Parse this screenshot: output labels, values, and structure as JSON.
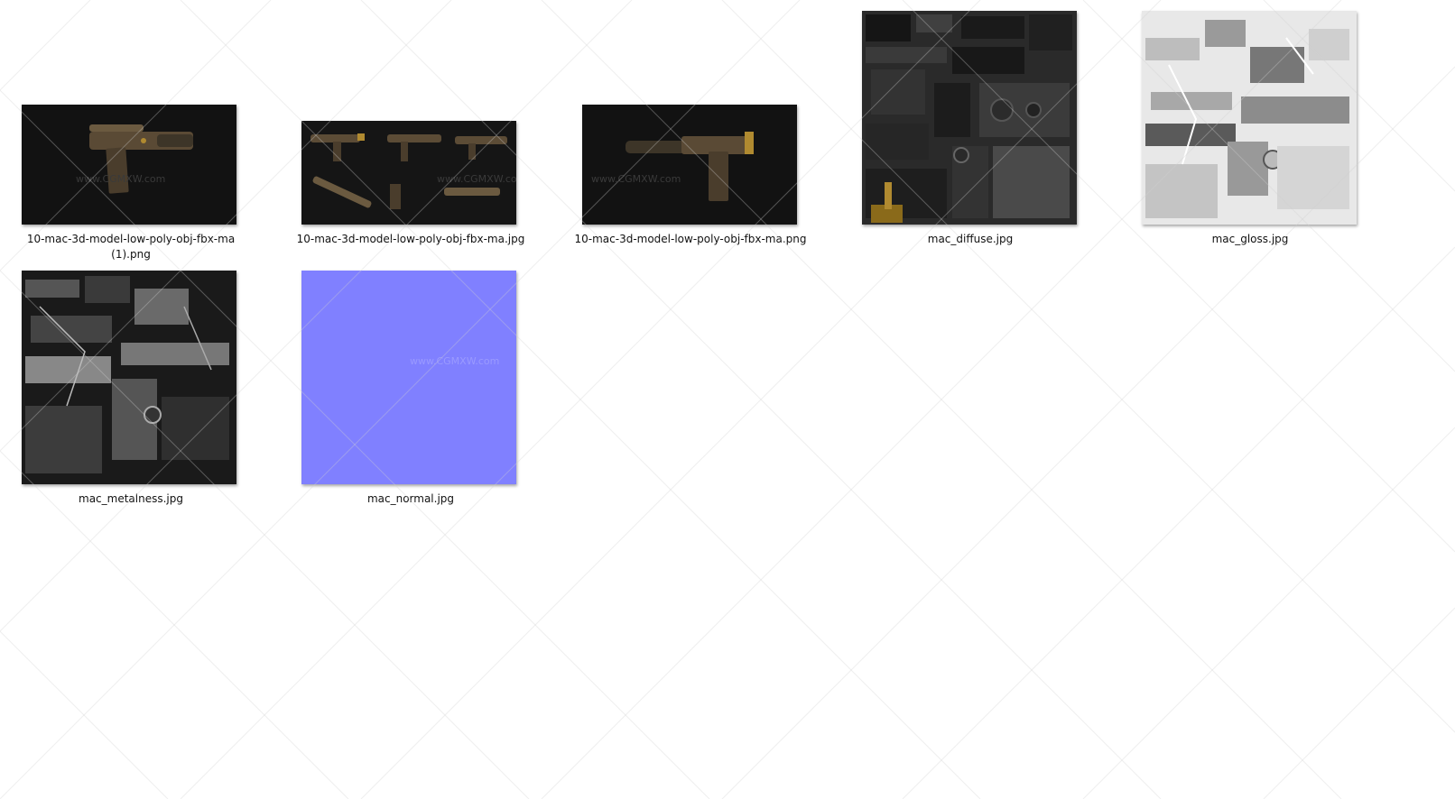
{
  "files": [
    {
      "name": "10-mac-3d-model-low-poly-obj-fbx-ma (1).png",
      "label_line1": "10-mac-3d-model-low-poly-obj-fbx-ma",
      "label_line2": "(1).png",
      "thumb_icon": "gun-render-thumbnail"
    },
    {
      "name": "10-mac-3d-model-low-poly-obj-fbx-ma.jpg",
      "label_line1": "10-mac-3d-model-low-poly-obj-fbx-ma.jpg",
      "label_line2": "",
      "thumb_icon": "gun-views-thumbnail"
    },
    {
      "name": "10-mac-3d-model-low-poly-obj-fbx-ma.png",
      "label_line1": "10-mac-3d-model-low-poly-obj-fbx-ma.png",
      "label_line2": "",
      "thumb_icon": "gun-render-thumbnail"
    },
    {
      "name": "mac_diffuse.jpg",
      "label_line1": "mac_diffuse.jpg",
      "label_line2": "",
      "thumb_icon": "diffuse-texture-thumbnail"
    },
    {
      "name": "mac_gloss.jpg",
      "label_line1": "mac_gloss.jpg",
      "label_line2": "",
      "thumb_icon": "gloss-texture-thumbnail"
    },
    {
      "name": "mac_metalness.jpg",
      "label_line1": "mac_metalness.jpg",
      "label_line2": "",
      "thumb_icon": "metalness-texture-thumbnail"
    },
    {
      "name": "mac_normal.jpg",
      "label_line1": "mac_normal.jpg",
      "label_line2": "",
      "thumb_icon": "normal-texture-thumbnail"
    }
  ],
  "thumb_watermark": "www.CGMXW.com",
  "colors": {
    "render_bg": "#111111",
    "normal_map": "#8080ff",
    "diffuse_dark": "#2a2a2a",
    "gloss_light": "#e8e8e8",
    "metal_dark": "#1a1a1a"
  }
}
